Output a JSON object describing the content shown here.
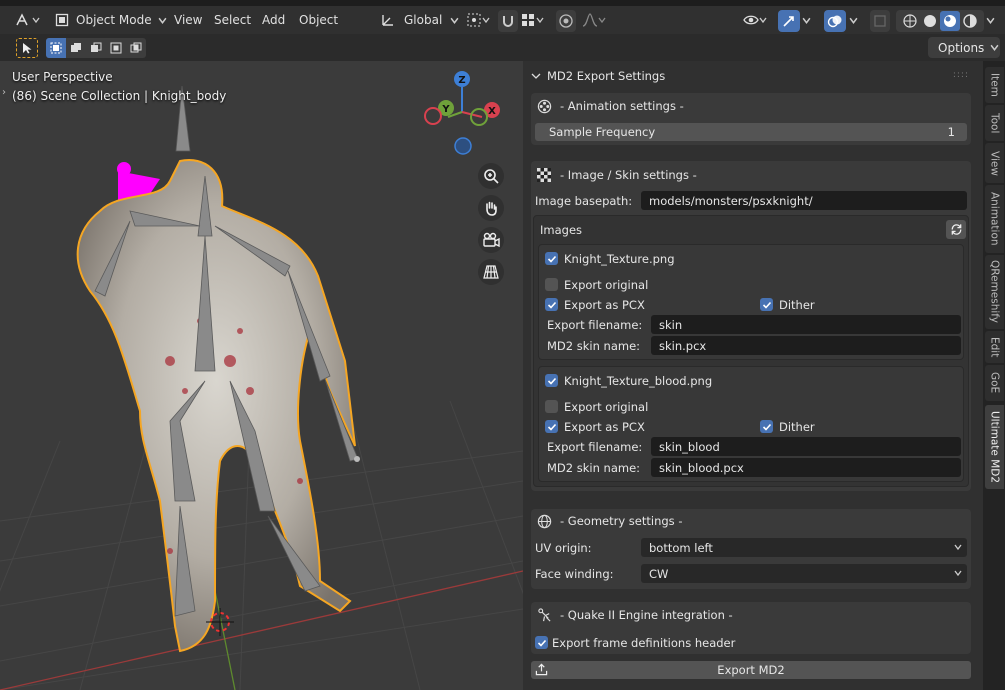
{
  "header": {
    "mode_label": "Object Mode",
    "menus": [
      "View",
      "Select",
      "Add",
      "Object"
    ],
    "transform_orientation": "Global",
    "options_label": "Options"
  },
  "viewport": {
    "perspective_label": "User Perspective",
    "collection_label": "(86) Scene Collection | Knight_body",
    "gizmo_axes": {
      "z": "Z",
      "y": "Y",
      "x": "X"
    }
  },
  "panel": {
    "title": "MD2 Export Settings",
    "animation": {
      "title": "- Animation settings -",
      "sample_frequency_label": "Sample Frequency",
      "sample_frequency_value": "1"
    },
    "image_skin": {
      "title": "- Image / Skin settings -",
      "basepath_label": "Image basepath:",
      "basepath_value": "models/monsters/psxknight/",
      "images_label": "Images",
      "items": [
        {
          "name": "Knight_Texture.png",
          "export_original_label": "Export original",
          "export_pcx_label": "Export as PCX",
          "dither_label": "Dither",
          "filename_label": "Export filename:",
          "filename_value": "skin",
          "skin_name_label": "MD2 skin name:",
          "skin_name_value": "skin.pcx"
        },
        {
          "name": "Knight_Texture_blood.png",
          "export_original_label": "Export original",
          "export_pcx_label": "Export as PCX",
          "dither_label": "Dither",
          "filename_label": "Export filename:",
          "filename_value": "skin_blood",
          "skin_name_label": "MD2 skin name:",
          "skin_name_value": "skin_blood.pcx"
        }
      ]
    },
    "geometry": {
      "title": "- Geometry settings -",
      "uv_origin_label": "UV origin:",
      "uv_origin_value": "bottom left",
      "face_winding_label": "Face winding:",
      "face_winding_value": "CW"
    },
    "quake": {
      "title": "- Quake II Engine integration -",
      "export_header_label": "Export frame definitions header"
    },
    "export_button_label": "Export MD2"
  },
  "tabs": [
    "Item",
    "Tool",
    "View",
    "Animation",
    "QRemeshify",
    "Edit",
    "GoE",
    "Ultimate MD2"
  ],
  "colors": {
    "accent": "#4772b3",
    "selection_outline": "#f5a623",
    "bone": "#8a8a8a",
    "armature_pose": "#ff00ff"
  }
}
